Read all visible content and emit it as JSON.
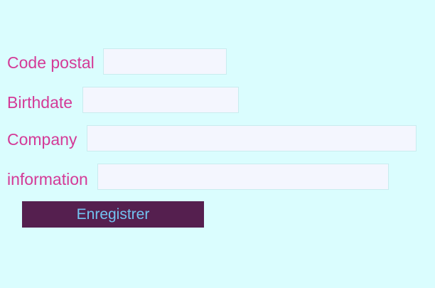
{
  "form": {
    "fields": [
      {
        "label": "Code postal",
        "value": "",
        "placeholder": ""
      },
      {
        "label": "Birthdate",
        "value": "",
        "placeholder": ""
      },
      {
        "label": "Company",
        "value": "",
        "placeholder": ""
      },
      {
        "label": "information",
        "value": "",
        "placeholder": ""
      }
    ],
    "submit_label": "Enregistrer"
  },
  "colors": {
    "background": "#dafdfe",
    "label": "#d43a97",
    "field_background": "#f4f6fe",
    "field_border": "#c9ecef",
    "button_background": "#551f4f",
    "button_text": "#72c3f1"
  }
}
